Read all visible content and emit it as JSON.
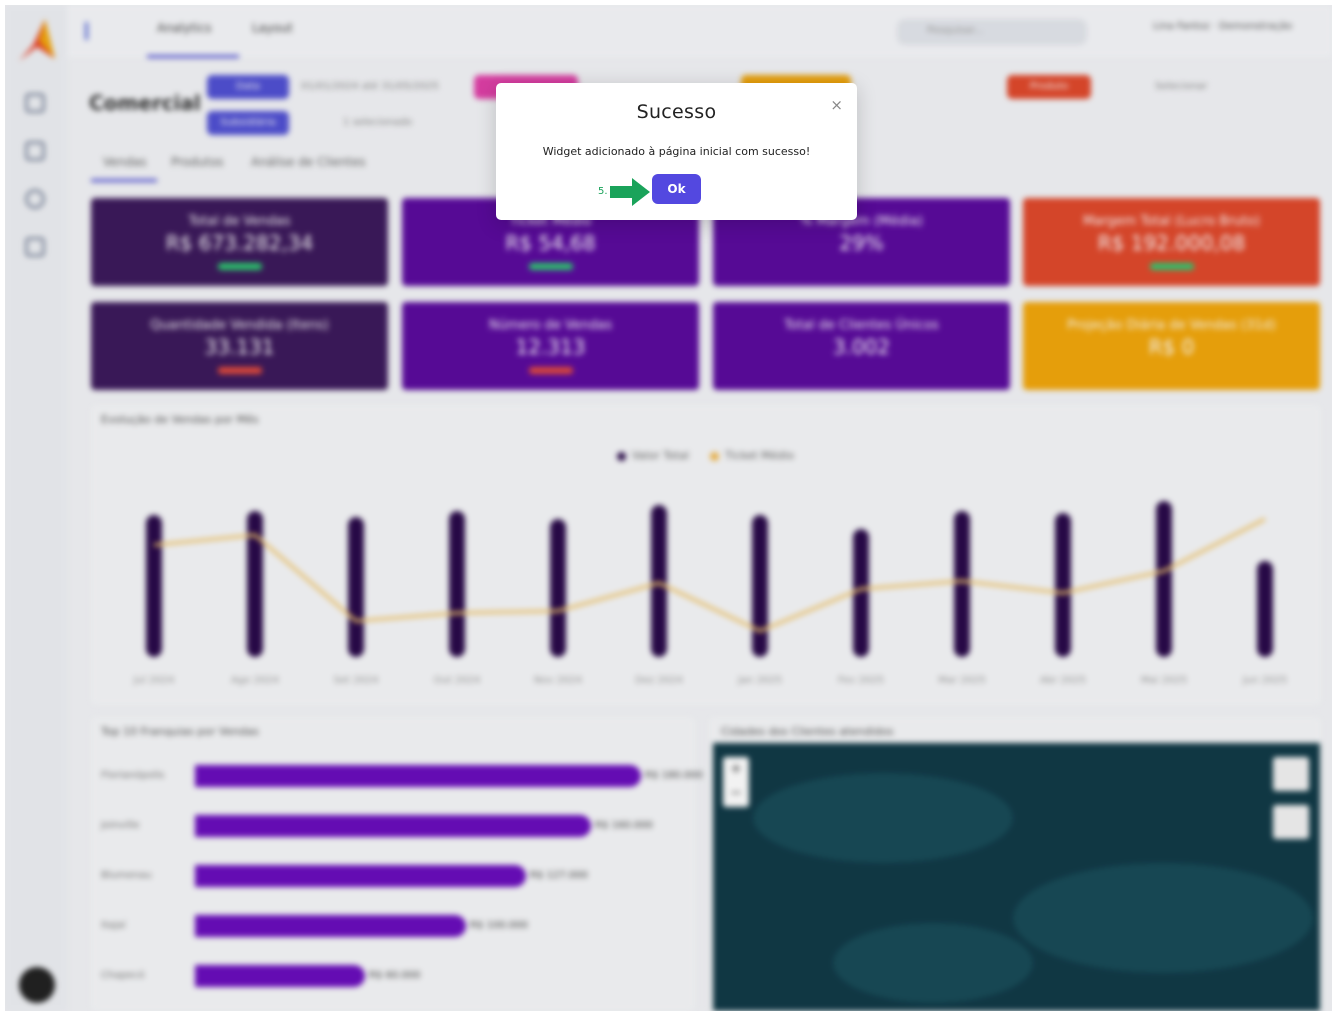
{
  "app": {
    "top_tabs": [
      "Analytics",
      "Layout"
    ],
    "user": "Lina Fantoz · Demonstração",
    "search_placeholder": "Pesquisar...",
    "page_title": "Comercial",
    "filters": {
      "date_chip": "Data",
      "date_range": "01/01/2024 até 31/05/2025",
      "subsidiary_chip": "Subsidiária",
      "subsidiary_value": "1 selecionado",
      "product_chip": "Produto",
      "product_value": "Selecionar"
    },
    "sub_tabs": [
      "Vendas",
      "Produtos",
      "Análise de Clientes"
    ],
    "kpis": [
      {
        "label": "Total de Vendas",
        "value": "R$ 673.282,34",
        "color": "#3d1a5c",
        "delta_color": "#2ecc71"
      },
      {
        "label": "Ticket Médio",
        "value": "R$ 54,68",
        "color": "#5b0b9e",
        "delta_color": "#2ecc71"
      },
      {
        "label": "% Margem (Média)",
        "value": "29%",
        "color": "#5b0b9e",
        "delta_color": ""
      },
      {
        "label": "Margem Total (Lucro Bruto)",
        "value": "R$ 192.000,08",
        "color": "#e0492c",
        "delta_color": "#2ecc71"
      },
      {
        "label": "Quantidade Vendida (Itens)",
        "value": "33.131",
        "color": "#3d1a5c",
        "delta_color": "#e74c3c"
      },
      {
        "label": "Número de Vendas",
        "value": "12.313",
        "color": "#5b0b9e",
        "delta_color": "#e74c3c"
      },
      {
        "label": "Total de Clientes Únicos",
        "value": "3.002",
        "color": "#5b0b9e",
        "delta_color": ""
      },
      {
        "label": "Projeção Diária de Vendas (31d)",
        "value": "R$ 0",
        "color": "#f2a70c",
        "delta_color": ""
      }
    ],
    "chart_title": "Evolução de Vendas por Mês",
    "legend": [
      "Valor Total",
      "Ticket Médio"
    ],
    "months": [
      "Jul 2024",
      "Ago 2024",
      "Set 2024",
      "Out 2024",
      "Nov 2024",
      "Dez 2024",
      "Jan 2025",
      "Fev 2025",
      "Mar 2025",
      "Abr 2025",
      "Mai 2025",
      "Jun 2025"
    ],
    "bottom_left_title": "Top 10 Franquias por Vendas",
    "franchises": [
      {
        "name": "Florianópolis",
        "value": "R$ 180.000",
        "fraction": 0.97
      },
      {
        "name": "Joinville",
        "value": "R$ 160.000",
        "fraction": 0.86
      },
      {
        "name": "Blumenau",
        "value": "R$ 127.000",
        "fraction": 0.72
      },
      {
        "name": "Itajaí",
        "value": "R$ 100.000",
        "fraction": 0.59
      },
      {
        "name": "Chapecó",
        "value": "R$ 60.000",
        "fraction": 0.37
      }
    ],
    "bottom_right_title": "Cidades dos Clientes atendidos"
  },
  "modal": {
    "title": "Sucesso",
    "message": "Widget adicionado à página inicial com sucesso!",
    "ok_label": "Ok",
    "close_label": "×",
    "step_label": "5.",
    "arrow_color": "#1aa35a"
  }
}
